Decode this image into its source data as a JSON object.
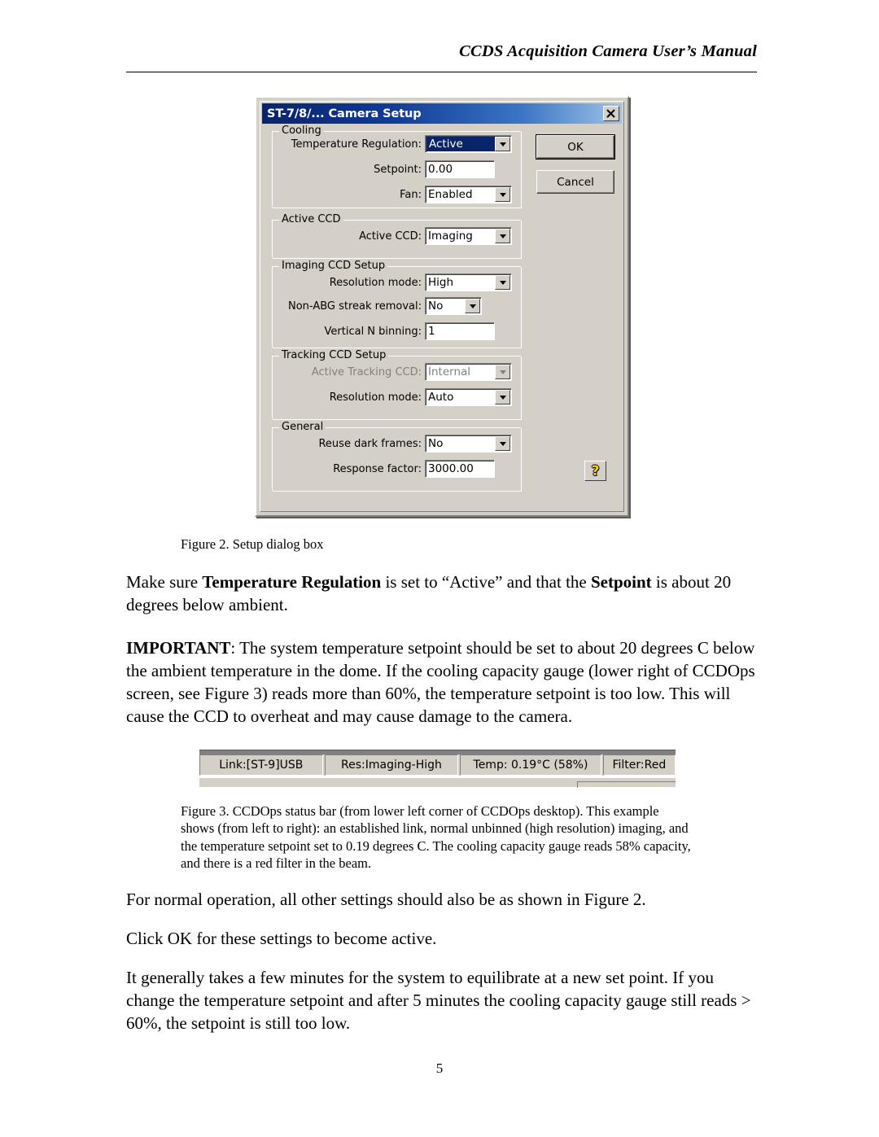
{
  "header": {
    "title": "CCDS Acquisition Camera User’s Manual"
  },
  "dialog": {
    "title": "ST-7/8/... Camera Setup",
    "close_icon": "close-icon",
    "buttons": {
      "ok": "OK",
      "cancel": "Cancel",
      "help": "?"
    },
    "groups": [
      {
        "legend": "Cooling",
        "fields": [
          {
            "label": "Temperature Regulation:",
            "value": "Active",
            "type": "combo",
            "state": "selected"
          },
          {
            "label": "Setpoint:",
            "value": "0.00",
            "type": "text"
          },
          {
            "label": "Fan:",
            "value": "Enabled",
            "type": "combo"
          }
        ]
      },
      {
        "legend": "Active CCD",
        "fields": [
          {
            "label": "Active CCD:",
            "value": "Imaging",
            "type": "combo"
          }
        ]
      },
      {
        "legend": "Imaging CCD Setup",
        "fields": [
          {
            "label": "Resolution mode:",
            "value": "High",
            "type": "combo"
          },
          {
            "label": "Non-ABG streak removal:",
            "value": "No",
            "type": "combo"
          },
          {
            "label": "Vertical N binning:",
            "value": "1",
            "type": "text"
          }
        ]
      },
      {
        "legend": "Tracking CCD Setup",
        "fields": [
          {
            "label": "Active Tracking CCD:",
            "value": "Internal",
            "type": "combo",
            "state": "disabled"
          },
          {
            "label": "Resolution mode:",
            "value": "Auto",
            "type": "combo"
          }
        ]
      },
      {
        "legend": "General",
        "fields": [
          {
            "label": "Reuse dark frames:",
            "value": "No",
            "type": "combo"
          },
          {
            "label": "Response factor:",
            "value": "3000.00",
            "type": "text"
          }
        ]
      }
    ]
  },
  "figure2_caption": "Figure 2. Setup dialog box",
  "paragraph1": {
    "seg1": "Make sure ",
    "bold1": "Temperature Regulation",
    "seg2": " is set to “Active” and that the ",
    "bold2": "Setpoint",
    "seg3": " is about 20 degrees below ambient."
  },
  "paragraph2": {
    "bold1": "IMPORTANT",
    "seg1": ":  The system temperature setpoint should be set to about 20 degrees C below the ambient temperature in the dome.  If the cooling capacity gauge (lower right of CCDOps screen, see Figure 3) reads more than 60%, the temperature setpoint is too low.  This will cause the CCD to overheat and may cause damage to the camera."
  },
  "status_bar": {
    "panes": [
      {
        "name": "link",
        "text": "Link:[ST-9]USB"
      },
      {
        "name": "resolution",
        "text": "Res:Imaging-High"
      },
      {
        "name": "temperature",
        "text": "Temp: 0.19°C (58%)"
      },
      {
        "name": "filter",
        "text": "Filter:Red"
      }
    ]
  },
  "figure3_caption": "Figure 3. CCDOps status bar (from lower left corner of CCDOps desktop).  This example shows (from left to right): an established link, normal unbinned (high resolution) imaging, and the temperature setpoint set to 0.19 degrees C.  The cooling capacity gauge reads 58% capacity, and there is a red filter in the beam.",
  "paragraph3": "For normal operation, all other settings should also be as shown in Figure 2.",
  "paragraph4": "Click OK for these settings to become active.",
  "paragraph5": "It generally takes a few minutes for the system to equilibrate at a new set point.  If you change the temperature setpoint and after 5 minutes the cooling capacity gauge still reads > 60%, the setpoint is still too low.",
  "page_number": "5"
}
